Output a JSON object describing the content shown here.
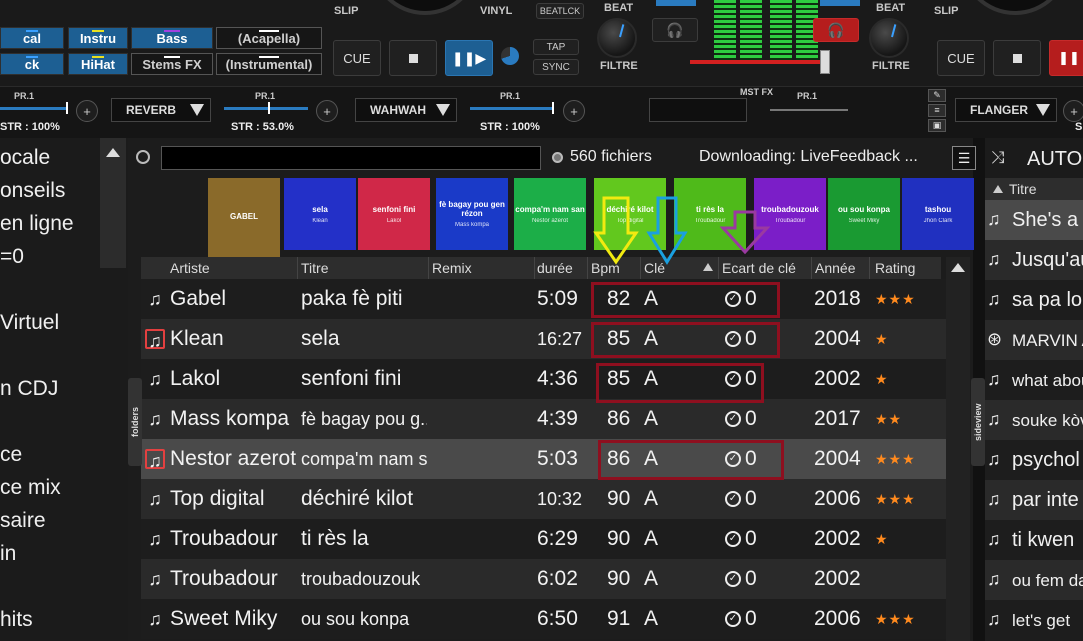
{
  "deck_left": {
    "pads": [
      {
        "label": "cal",
        "style": "blue",
        "bar": "#3aa0ff"
      },
      {
        "label": "Instru",
        "style": "blue",
        "bar": "#e8e020"
      },
      {
        "label": "Bass",
        "style": "blue",
        "bar": "#a040e0"
      },
      {
        "label": "(Acapella)",
        "style": "dark",
        "bar": "#ffffff"
      },
      {
        "label": "ck",
        "style": "blue",
        "bar": "#3aa0ff"
      },
      {
        "label": "HiHat",
        "style": "blue",
        "bar": "#e8e020"
      },
      {
        "label": "Stems FX",
        "style": "dark",
        "bar": "#ffffff"
      },
      {
        "label": "(Instrumental)",
        "style": "dark",
        "bar": "#ffffff"
      }
    ],
    "slip": "SLIP",
    "vinyl": "VINYL",
    "beatlock": "BEATLCK",
    "cue": "CUE",
    "tap": "TAP",
    "sync": "SYNC"
  },
  "mixer": {
    "beat_left": "BEAT",
    "beat_right": "BEAT",
    "filter_left": "FILTRE",
    "filter_right": "FILTRE",
    "mst_fx": "MST FX",
    "pr": "PR.1"
  },
  "deck_right": {
    "slip": "SLIP",
    "cue": "CUE"
  },
  "fx_strip": {
    "units": [
      {
        "name": "REVERB",
        "str": "STR : 53.0%",
        "pr": "PR.1"
      },
      {
        "name": "WAHWAH",
        "str": "STR : 100%",
        "pr": "PR.1"
      },
      {
        "name": "FLANGER",
        "str": "S",
        "pr": "PR.1"
      }
    ],
    "left_str": "STR : 100%",
    "left_pr": "PR.1",
    "plus": "+"
  },
  "sidebar": {
    "items": [
      "ocale",
      "onseils",
      "en ligne",
      "=0",
      "Virtuel",
      "n CDJ",
      "ce",
      "ce mix",
      "saire",
      "in",
      "hits"
    ]
  },
  "browser": {
    "search_placeholder": "",
    "file_count": "560 fichiers",
    "downloading": "Downloading: LiveFeedback ...",
    "side_left": "folders",
    "side_right": "sideview",
    "covers": [
      {
        "title": "GABEL",
        "artist": "",
        "color": "#8a6a2a"
      },
      {
        "title": "sela",
        "artist": "Klean",
        "color": "#2330c8"
      },
      {
        "title": "senfoni fini",
        "artist": "Lakol",
        "color": "#d02848"
      },
      {
        "title": "fè bagay pou gen rézon",
        "artist": "Mass kompa",
        "color": "#1a3ac8"
      },
      {
        "title": "compa'm nam san",
        "artist": "Nestor azerot",
        "color": "#1cae48"
      },
      {
        "title": "déchiré kilot",
        "artist": "Top digital",
        "color": "#62c81e"
      },
      {
        "title": "ti rès la",
        "artist": "Troubadour",
        "color": "#4fba1a"
      },
      {
        "title": "troubadouzouk",
        "artist": "Troubadour",
        "color": "#7b1ec8"
      },
      {
        "title": "ou sou konpa",
        "artist": "Sweet Miky",
        "color": "#1a9a32"
      },
      {
        "title": "tashou",
        "artist": "Jhon Clark",
        "color": "#2030c0"
      }
    ],
    "columns": [
      "Artiste",
      "Titre",
      "Remix",
      "durée",
      "Bpm",
      "Clé",
      "Ecart de clé",
      "Année",
      "Rating"
    ],
    "rows": [
      {
        "artist": "Gabel",
        "title": "paka fè piti",
        "duration": "5:09",
        "bpm": "82",
        "key": "A",
        "gap": "0",
        "year": "2018",
        "rating": "★★★",
        "boxed": false
      },
      {
        "artist": "Klean",
        "title": "sela",
        "duration": "16:27",
        "bpm": "85",
        "key": "A",
        "gap": "0",
        "year": "2004",
        "rating": "★",
        "boxed": true
      },
      {
        "artist": "Lakol",
        "title": "senfoni fini",
        "duration": "4:36",
        "bpm": "85",
        "key": "A",
        "gap": "0",
        "year": "2002",
        "rating": "★",
        "boxed": false
      },
      {
        "artist": "Mass kompa",
        "title": "fè bagay pou g...",
        "duration": "4:39",
        "bpm": "86",
        "key": "A",
        "gap": "0",
        "year": "2017",
        "rating": "★★",
        "boxed": false
      },
      {
        "artist": "Nestor azerot",
        "title": "compa'm nam san",
        "duration": "5:03",
        "bpm": "86",
        "key": "A",
        "gap": "0",
        "year": "2004",
        "rating": "★★★",
        "boxed": true
      },
      {
        "artist": "Top digital",
        "title": "déchiré kilot",
        "duration": "10:32",
        "bpm": "90",
        "key": "A",
        "gap": "0",
        "year": "2006",
        "rating": "★★★",
        "boxed": false
      },
      {
        "artist": "Troubadour",
        "title": "ti rès la",
        "duration": "6:29",
        "bpm": "90",
        "key": "A",
        "gap": "0",
        "year": "2002",
        "rating": "★",
        "boxed": false
      },
      {
        "artist": "Troubadour",
        "title": "troubadouzouk",
        "duration": "6:02",
        "bpm": "90",
        "key": "A",
        "gap": "0",
        "year": "2002",
        "rating": "",
        "boxed": false
      },
      {
        "artist": "Sweet Miky",
        "title": "ou sou konpa",
        "duration": "6:50",
        "bpm": "91",
        "key": "A",
        "gap": "0",
        "year": "2006",
        "rating": "★★★",
        "boxed": false
      }
    ],
    "selected_row": 4
  },
  "right_panel": {
    "title": "AUTO",
    "column": "Titre",
    "items": [
      {
        "icon": "♫",
        "text": "She's a"
      },
      {
        "icon": "♫",
        "text": "Jusqu'au"
      },
      {
        "icon": "♫",
        "text": "sa pa lo"
      },
      {
        "icon": "⊛",
        "text": "MARVIN A"
      },
      {
        "icon": "♫",
        "text": "what abou"
      },
      {
        "icon": "♫",
        "text": "souke kòv"
      },
      {
        "icon": "♫",
        "text": "psychol"
      },
      {
        "icon": "♫",
        "text": "par inte"
      },
      {
        "icon": "♫",
        "text": "ti kwen"
      },
      {
        "icon": "♫",
        "text": "ou fem da"
      },
      {
        "icon": "♫",
        "text": "let's get"
      }
    ]
  },
  "colors": {
    "accent_blue": "#1d5f93",
    "highlight_red": "#8e0f1f",
    "arrow_yellow": "#f2ea10",
    "arrow_blue": "#1aa0e0",
    "arrow_purple": "#9a3aa0",
    "star_orange": "#ff8a1e"
  }
}
